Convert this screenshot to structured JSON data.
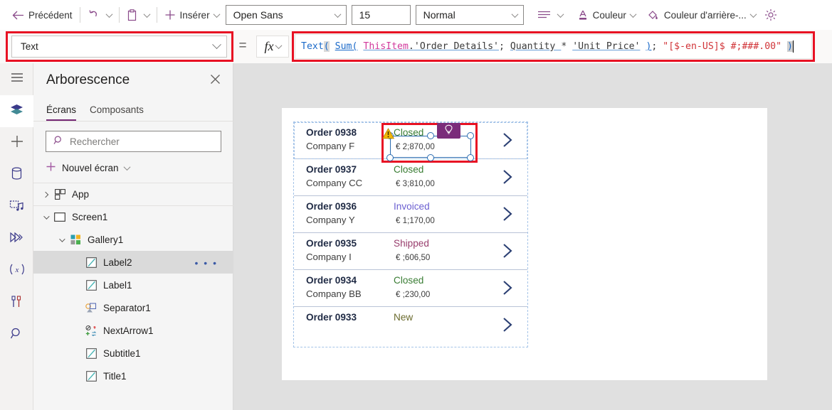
{
  "toolbar": {
    "back_label": "Précédent",
    "insert_label": "Insérer",
    "color_label": "Couleur",
    "background_color_label": "Couleur d'arrière-...",
    "font_value": "Open Sans",
    "font_size_value": "15",
    "font_weight_value": "Normal",
    "icons": {
      "back": "back-arrow-icon",
      "undo": "undo-icon",
      "paste": "paste-icon",
      "insert": "plus-icon",
      "align": "align-icon",
      "color": "font-color-icon",
      "background": "fill-color-icon",
      "settings": "gear-icon"
    }
  },
  "formula_bar": {
    "property_value": "Text",
    "equals": "=",
    "fx_label": "fx",
    "formula_tokens": [
      {
        "text": "Text",
        "type": "fn"
      },
      {
        "text": "(",
        "type": "paren-hl"
      },
      {
        "text": " ",
        "type": "punc"
      },
      {
        "text": "Sum(",
        "type": "fn2"
      },
      {
        "text": " ",
        "type": "punc"
      },
      {
        "text": "ThisItem",
        "type": "item"
      },
      {
        "text": ".",
        "type": "field"
      },
      {
        "text": "'Order Details'",
        "type": "field"
      },
      {
        "text": "; ",
        "type": "punc"
      },
      {
        "text": "Quantity ",
        "type": "field"
      },
      {
        "text": "* ",
        "type": "punc"
      },
      {
        "text": "'Unit Price'",
        "type": "field"
      },
      {
        "text": " ",
        "type": "punc"
      },
      {
        "text": ")",
        "type": "fn2"
      },
      {
        "text": "; ",
        "type": "punc"
      },
      {
        "text": "\"[$-en-US]$ #;###.00\"",
        "type": "str"
      },
      {
        "text": " ",
        "type": "punc"
      },
      {
        "text": ")",
        "type": "paren-hl2"
      }
    ],
    "formula_plain": "Text( Sum( ThisItem.'Order Details'; Quantity * 'Unit Price' ); \"[$-en-US]$ #;###.00\" )"
  },
  "rail": {
    "items": [
      {
        "name": "hamburger-menu-icon",
        "selected": false
      },
      {
        "name": "tree-view-icon",
        "selected": true
      },
      {
        "name": "insert-plus-icon",
        "selected": false
      },
      {
        "name": "data-source-icon",
        "selected": false
      },
      {
        "name": "media-icon",
        "selected": false
      },
      {
        "name": "power-automate-icon",
        "selected": false
      },
      {
        "name": "variables-icon",
        "selected": false
      },
      {
        "name": "tools-icon",
        "selected": false
      },
      {
        "name": "search-icon",
        "selected": false
      }
    ]
  },
  "tree_panel": {
    "title": "Arborescence",
    "tabs": [
      {
        "label": "Écrans",
        "active": true
      },
      {
        "label": "Composants",
        "active": false
      }
    ],
    "search_placeholder": "Rechercher",
    "new_screen_label": "Nouvel écran",
    "items": [
      {
        "label": "App",
        "indent": 0,
        "expander": "right",
        "icon": "app-icon",
        "selected": false,
        "divider": true
      },
      {
        "label": "Screen1",
        "indent": 0,
        "expander": "down",
        "icon": "screen-icon",
        "selected": false,
        "divider": true
      },
      {
        "label": "Gallery1",
        "indent": 1,
        "expander": "down",
        "icon": "gallery-icon",
        "selected": false,
        "divider": false
      },
      {
        "label": "Label2",
        "indent": 2,
        "expander": "none",
        "icon": "label-icon",
        "selected": true,
        "divider": false
      },
      {
        "label": "Label1",
        "indent": 2,
        "expander": "none",
        "icon": "label-icon",
        "selected": false,
        "divider": false
      },
      {
        "label": "Separator1",
        "indent": 2,
        "expander": "none",
        "icon": "separator-icon",
        "selected": false,
        "divider": false
      },
      {
        "label": "NextArrow1",
        "indent": 2,
        "expander": "none",
        "icon": "icon-control-icon",
        "selected": false,
        "divider": false
      },
      {
        "label": "Subtitle1",
        "indent": 2,
        "expander": "none",
        "icon": "label-icon",
        "selected": false,
        "divider": false
      },
      {
        "label": "Title1",
        "indent": 2,
        "expander": "none",
        "icon": "label-icon",
        "selected": false,
        "divider": false
      }
    ],
    "overflow_dots": "• • •"
  },
  "canvas": {
    "gallery_rows": [
      {
        "title": "Order 0938",
        "subtitle": "Company F",
        "status": "Closed",
        "status_color": "#3a7d34",
        "amount": "€ 2;870,00",
        "arrow": true,
        "selected_row": true
      },
      {
        "title": "Order 0937",
        "subtitle": "Company CC",
        "status": "Closed",
        "status_color": "#3a7d34",
        "amount": "€ 3;810,00",
        "arrow": true,
        "selected_row": false
      },
      {
        "title": "Order 0936",
        "subtitle": "Company Y",
        "status": "Invoiced",
        "status_color": "#6b5fd1",
        "amount": "€ 1;170,00",
        "arrow": true,
        "selected_row": false
      },
      {
        "title": "Order 0935",
        "subtitle": "Company I",
        "status": "Shipped",
        "status_color": "#993f6e",
        "amount": "€ ;606,50",
        "arrow": true,
        "selected_row": false
      },
      {
        "title": "Order 0934",
        "subtitle": "Company BB",
        "status": "Closed",
        "status_color": "#3a7d34",
        "amount": "€ ;230,00",
        "arrow": true,
        "selected_row": false
      },
      {
        "title": "Order 0933",
        "subtitle": "",
        "status": "New",
        "status_color": "#6b6b2e",
        "amount": "",
        "arrow": true,
        "selected_row": false
      }
    ],
    "selected_control": {
      "name": "Label2",
      "warning_icon": "warning-triangle-icon",
      "badge_icon": "pen-tool-icon",
      "badge_color": "#7a2c7a"
    }
  },
  "colors": {
    "accent_purple": "#742774",
    "highlight_red": "#e81123",
    "selection_blue": "#2b6cb0"
  }
}
